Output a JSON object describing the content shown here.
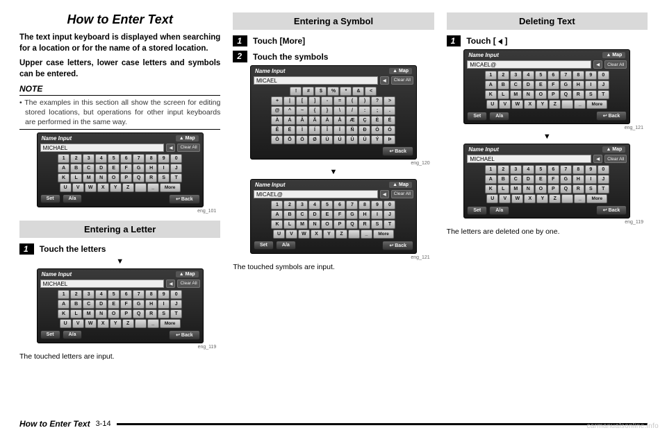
{
  "col1": {
    "title": "How to Enter Text",
    "intro1": "The text input keyboard is displayed when searching for a location or for the name of a stored location.",
    "intro2": "Upper case letters, lower case letters and symbols can be entered.",
    "noteLabel": "NOTE",
    "noteBullet": "•",
    "noteBody": "The examples in this section all show the screen for editing stored locations, but operations for other input keyboards are performed in the same way.",
    "kbd1": {
      "title": "Name Input",
      "map": "▲ Map",
      "field": "MICHAEL",
      "back": "◀",
      "clear": "Clear All",
      "rows": [
        [
          "1",
          "2",
          "3",
          "4",
          "5",
          "6",
          "7",
          "8",
          "9",
          "0"
        ],
        [
          "A",
          "B",
          "C",
          "D",
          "E",
          "F",
          "G",
          "H",
          "I",
          "J"
        ],
        [
          "K",
          "L",
          "M",
          "N",
          "O",
          "P",
          "Q",
          "R",
          "S",
          "T"
        ],
        [
          "U",
          "V",
          "W",
          "X",
          "Y",
          "Z",
          "",
          "_",
          "More"
        ]
      ],
      "set": "Set",
      "aa": "A/a",
      "backBtn": "↩ Back"
    },
    "cap1": "eng_101",
    "section": "Entering a Letter",
    "step1": "Touch the letters",
    "downTri": "▼",
    "kbd2Field": "MICHAEL",
    "cap2": "eng_119",
    "result": "The touched letters are input."
  },
  "col2": {
    "section": "Entering a Symbol",
    "step1Num": "1",
    "step1": "Touch [More]",
    "step2Num": "2",
    "step2": "Touch the symbols",
    "kbdSym": {
      "field": "MICAEL",
      "rows": [
        [
          "!",
          "#",
          "$",
          "%",
          "*",
          "&",
          "<"
        ],
        [
          "+",
          "|",
          "[",
          "]",
          "-",
          "=",
          "(",
          ")",
          "?",
          ">"
        ],
        [
          "@",
          "^",
          "~",
          "{",
          "}",
          "\\",
          "/",
          ":",
          ";",
          "."
        ],
        [
          "À",
          "Á",
          "Â",
          "Ã",
          "Ä",
          "Å",
          "Æ",
          "Ç",
          "È",
          "É"
        ],
        [
          "Ê",
          "Ë",
          "Ì",
          "Í",
          "Î",
          "Ï",
          "Ñ",
          "Ð",
          "Ò",
          "Ó"
        ],
        [
          "Ô",
          "Õ",
          "Ö",
          "Ø",
          "Ù",
          "Ú",
          "Û",
          "Ü",
          "Ý",
          "Þ"
        ]
      ]
    },
    "cap1": "eng_120",
    "downTri": "▼",
    "kbd2Field": "MICAEL@",
    "cap2": "eng_121",
    "result": "The touched symbols are input."
  },
  "col3": {
    "section": "Deleting Text",
    "step1Num": "1",
    "step1a": "Touch [ ",
    "step1b": " ]",
    "kbd1Field": "MICAEL@",
    "cap1": "eng_121",
    "downTri": "▼",
    "kbd2Field": "MICHAEL",
    "cap2": "eng_119",
    "result": "The letters are deleted one by one."
  },
  "footer": {
    "title": "How to Enter Text",
    "page": "3-14"
  },
  "watermark": "carmanualsonline.info",
  "stepNums": {
    "one": "1",
    "two": "2"
  }
}
